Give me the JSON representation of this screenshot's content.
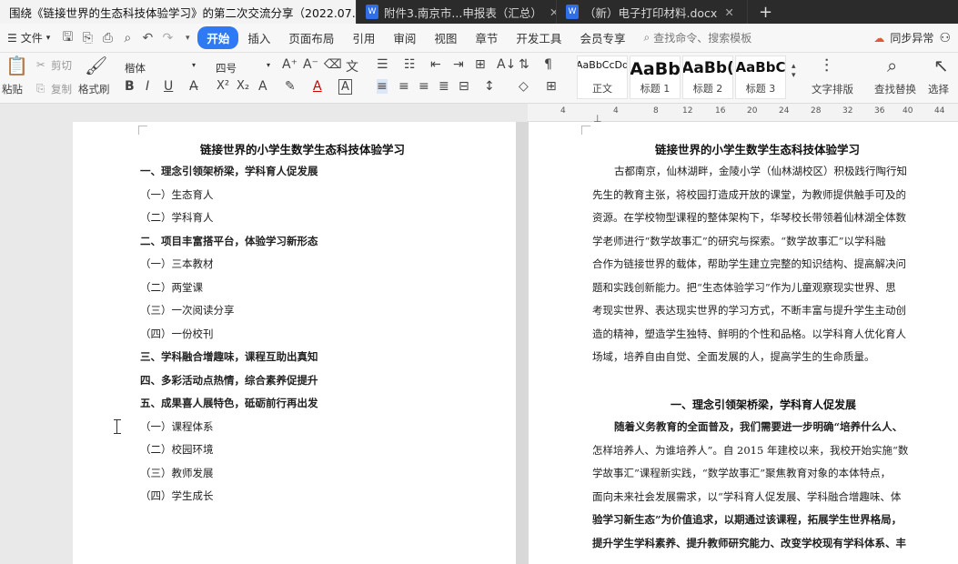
{
  "tabs": [
    {
      "label": "围绕《链接世界的生态科技体验学习》的第二次交流分享（2022.07.31）",
      "active": true
    },
    {
      "label": "附件3.南京市...申报表（汇总）",
      "active": false
    },
    {
      "label": "（新）电子打印材料.docx",
      "active": false
    }
  ],
  "tab_add": "+",
  "menu": {
    "file": "文件",
    "tabs": [
      "开始",
      "插入",
      "页面布局",
      "引用",
      "审阅",
      "视图",
      "章节",
      "开发工具",
      "会员专享"
    ],
    "active_tab": "开始",
    "search_placeholder": "查找命令、搜索模板",
    "sync_status": "同步异常"
  },
  "ribbon": {
    "paste": "粘贴",
    "cut": "剪切",
    "copy": "复制",
    "format_painter": "格式刷",
    "font_name": "楷体",
    "font_size": "四号",
    "styles": [
      {
        "sample": "AaBbCcDd",
        "label": "正文"
      },
      {
        "sample": "AaBb",
        "label": "标题 1"
      },
      {
        "sample": "AaBb(",
        "label": "标题 2"
      },
      {
        "sample": "AaBbC",
        "label": "标题 3"
      }
    ],
    "text_layout": "文字排版",
    "find_replace": "查找替换",
    "select": "选择"
  },
  "ruler_ticks": [
    "4",
    "4",
    "8",
    "12",
    "16",
    "20",
    "24",
    "28",
    "32",
    "36",
    "40",
    "44"
  ],
  "left_page": {
    "title": "链接世界的小学生数学生态科技体验学习",
    "outline": [
      {
        "text": "一、理念引领架桥梁，学科育人促发展",
        "bold": true
      },
      {
        "text": "（一）生态育人",
        "bold": false
      },
      {
        "text": "（二）学科育人",
        "bold": false
      },
      {
        "text": "二、项目丰富搭平台，体验学习新形态",
        "bold": true
      },
      {
        "text": "（一）三本教材",
        "bold": false
      },
      {
        "text": "（二）两堂课",
        "bold": false
      },
      {
        "text": "（三）一次阅读分享",
        "bold": false
      },
      {
        "text": "（四）一份校刊",
        "bold": false
      },
      {
        "text": "三、学科融合增趣味，课程互助出真知",
        "bold": true
      },
      {
        "text": "四、多彩活动点热情，综合素养促提升",
        "bold": true
      },
      {
        "text": "五、成果喜人展特色，砥砺前行再出发",
        "bold": true
      },
      {
        "text": "（一）课程体系",
        "bold": false
      },
      {
        "text": "（二）校园环境",
        "bold": false
      },
      {
        "text": "（三）教师发展",
        "bold": false
      },
      {
        "text": "（四）学生成长",
        "bold": false
      }
    ]
  },
  "right_page": {
    "title": "链接世界的小学生数学生态科技体验学习",
    "intro_lines": [
      {
        "text": "古都南京，仙林湖畔，金陵小学（仙林湖校区）积极践行陶行知",
        "bold": false,
        "indent": true
      },
      {
        "text": "先生的教育主张，将校园打造成开放的课堂，为教师提供触手可及的",
        "bold": false,
        "indent": false
      },
      {
        "text": "资源。在学校物型课程的整体架构下，华琴校长带领着仙林湖全体数",
        "bold": false,
        "indent": false
      },
      {
        "text": "学老师进行“数学故事汇”的研究与探索。“数学故事汇”以学科融",
        "bold": false,
        "indent": false
      },
      {
        "text": "合作为链接世界的载体，帮助学生建立完整的知识结构、提高解决问",
        "bold": false,
        "indent": false
      },
      {
        "text": "题和实践创新能力。把“生态体验学习”作为儿童观察现实世界、思",
        "bold": false,
        "indent": false
      },
      {
        "text": "考现实世界、表达现实世界的学习方式，不断丰富与提升学生主动创",
        "bold": false,
        "indent": false
      },
      {
        "text": "造的精神，塑造学生独特、鲜明的个性和品格。以学科育人优化育人",
        "bold": false,
        "indent": false
      },
      {
        "text": "场域，培养自由自觉、全面发展的人，提高学生的生命质量。",
        "bold": false,
        "indent": false
      }
    ],
    "section_title": "一、理念引领架桥梁，学科育人促发展",
    "section_lines": [
      {
        "text": "随着义务教育的全面普及，我们需要进一步明确“培养什么人、",
        "bold": true,
        "indent": true
      },
      {
        "text": "怎样培养人、为谁培养人”。自 2015 年建校以来，我校开始实施“数",
        "bold": false,
        "indent": false
      },
      {
        "text": "学故事汇”课程新实践，“数学故事汇”聚焦教育对象的本体特点，",
        "bold": false,
        "indent": false
      },
      {
        "text": "面向未来社会发展需求，以“学科育人促发展、学科融合增趣味、体",
        "bold": false,
        "indent": false
      },
      {
        "text": "验学习新生态”为价值追求，以期通过该课程，拓展学生世界格局，",
        "bold": true,
        "indent": false
      },
      {
        "text": "提升学生学科素养、提升教师研究能力、改变学校现有学科体系、丰",
        "bold": true,
        "indent": false
      }
    ]
  }
}
